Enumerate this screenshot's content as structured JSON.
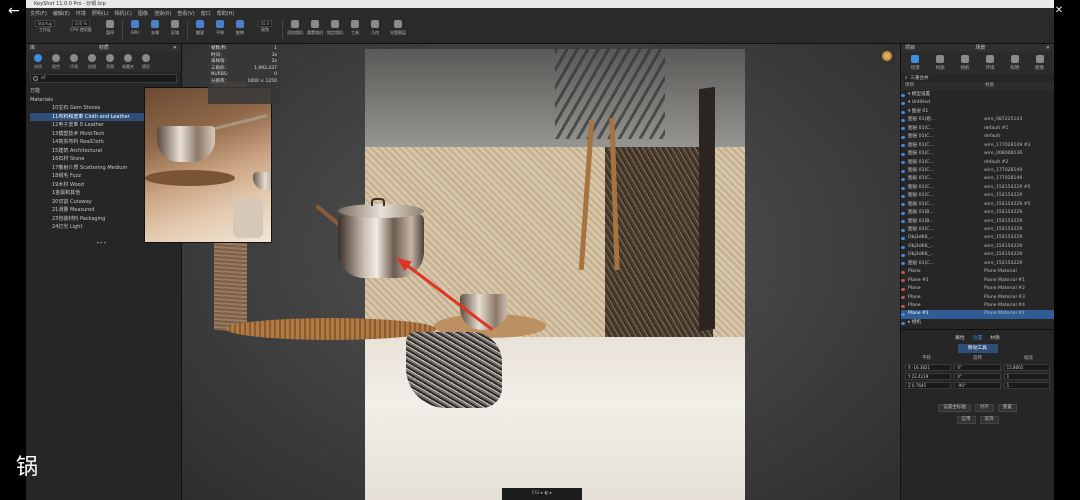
{
  "window": {
    "title": "KeyShot 11.0.0 Pro - 炒锅.bip",
    "controls": [
      "—",
      "▢",
      "✕"
    ]
  },
  "menu": [
    "文件(F)",
    "编辑(E)",
    "环境",
    "照明(L)",
    "相机(C)",
    "图像",
    "渲染(R)",
    "查看(V)",
    "窗口",
    "帮助(H)"
  ],
  "toolbar": {
    "workspace_value": "Startup",
    "workspace_label": "工作区",
    "cpu_value": "100 %",
    "cpu_label": "CPU 使用量",
    "pause_label": "暂停",
    "gpu_label": "GPU",
    "denoise_label": "去噪",
    "region_label": "区域",
    "tumble_label": "翻滚",
    "pan_label": "平移",
    "dolly_label": "推移",
    "fov_value": "45.0",
    "fov_label": "视角",
    "add_camera_label": "添加相机",
    "reset_camera_label": "重置相机",
    "lock_camera_label": "锁定相机",
    "tools_label": "工具",
    "geometry_label": "几何",
    "light_label": "光管图层"
  },
  "library": {
    "header_left": "库",
    "header_center": "材质",
    "tabs": [
      "材质",
      "颜色",
      "环境",
      "纹理",
      "背景",
      "收藏夹",
      "模型"
    ],
    "search_value": "ef",
    "tree": [
      {
        "label": "万能",
        "sub": false,
        "selected": false
      },
      {
        "label": "Materials",
        "sub": false,
        "selected": false
      },
      {
        "label": "10宝石 Gem Stones",
        "sub": true,
        "selected": false
      },
      {
        "label": "11布料和皮革 Cloth and Leather",
        "sub": true,
        "selected": true
      },
      {
        "label": "12电子皮革 E-Leather",
        "sub": true,
        "selected": false
      },
      {
        "label": "13模塑技术 Mold-Tech",
        "sub": true,
        "selected": false
      },
      {
        "label": "14真实布料 RealCloth",
        "sub": true,
        "selected": false
      },
      {
        "label": "15建筑 Architectural",
        "sub": true,
        "selected": false
      },
      {
        "label": "16石材 Stone",
        "sub": true,
        "selected": false
      },
      {
        "label": "17散射介质 Scattering Medium",
        "sub": true,
        "selected": false
      },
      {
        "label": "18绒毛 Fuzz",
        "sub": true,
        "selected": false
      },
      {
        "label": "19木材 Wood",
        "sub": true,
        "selected": false
      },
      {
        "label": "1金属和其他",
        "sub": true,
        "selected": false
      },
      {
        "label": "20切割 Cutaway",
        "sub": true,
        "selected": false
      },
      {
        "label": "21测量 Measured",
        "sub": true,
        "selected": false
      },
      {
        "label": "23包装材料 Packaging",
        "sub": true,
        "selected": false
      },
      {
        "label": "24灯光 Light",
        "sub": true,
        "selected": false
      }
    ]
  },
  "stats": [
    {
      "k": "帧数/秒：",
      "v": "1"
    },
    {
      "k": "时间：",
      "v": "3s"
    },
    {
      "k": "采样值：",
      "v": "2s"
    },
    {
      "k": "三角形：",
      "v": "1,992,437"
    },
    {
      "k": "NURBS：",
      "v": "0"
    },
    {
      "k": "分辨率：",
      "v": "1000 × 1250"
    }
  ],
  "viewport": {
    "bottom_bar": "FGI ▸ ◐ ▸"
  },
  "scene": {
    "header_left": "项目",
    "header_center": "场景",
    "tabs": [
      "场景",
      "材质",
      "相机",
      "环境",
      "照明",
      "图像"
    ],
    "filter_label": "三重合并",
    "col_name": "项目",
    "col_material": "材质",
    "rows": [
      {
        "name": "▾ 模型设置",
        "mat": "",
        "eye": "blue",
        "selected": false
      },
      {
        "name": "  ▾ Untitled",
        "mat": "",
        "eye": "blue",
        "selected": false
      },
      {
        "name": "    ▾ 图层 01",
        "mat": "",
        "eye": "blue",
        "selected": false
      },
      {
        "name": "      图层 01(组...",
        "mat": "wire_087225143",
        "eye": "blue",
        "selected": false
      },
      {
        "name": "      图层 01(C...",
        "mat": "default #1",
        "eye": "blue",
        "selected": false
      },
      {
        "name": "      图层 01(C...",
        "mat": "default",
        "eye": "blue",
        "selected": false
      },
      {
        "name": "      图层 01(C...",
        "mat": "wire_177028149 #3",
        "eye": "blue",
        "selected": false
      },
      {
        "name": "      图层 01(C...",
        "mat": "wire_008008136",
        "eye": "blue",
        "selected": false
      },
      {
        "name": "      图层 01(C...",
        "mat": "default #2",
        "eye": "blue",
        "selected": false
      },
      {
        "name": "      图层 01(C...",
        "mat": "wire_177028149",
        "eye": "blue",
        "selected": false
      },
      {
        "name": "      图层 01(C...",
        "mat": "wire_177028149",
        "eye": "blue",
        "selected": false
      },
      {
        "name": "      图层 01(C...",
        "mat": "wire_154154229 #5",
        "eye": "blue",
        "selected": false
      },
      {
        "name": "      图层 01(C...",
        "mat": "wire_154154229",
        "eye": "blue",
        "selected": false
      },
      {
        "name": "      图层 01(C...",
        "mat": "wire_154154229 #5",
        "eye": "blue",
        "selected": false
      },
      {
        "name": "      图层 01(B...",
        "mat": "wire_154154229",
        "eye": "blue",
        "selected": false
      },
      {
        "name": "      图层 01(B...",
        "mat": "wire_154154229",
        "eye": "blue",
        "selected": false
      },
      {
        "name": "      图层 01(C...",
        "mat": "wire_154154229",
        "eye": "blue",
        "selected": false
      },
      {
        "name": "      Obj3d66_...",
        "mat": "wire_154154229",
        "eye": "blue",
        "selected": false
      },
      {
        "name": "      Obj3d66_...",
        "mat": "wire_154154229",
        "eye": "blue",
        "selected": false
      },
      {
        "name": "      Obj3d66_...",
        "mat": "wire_154154229",
        "eye": "blue",
        "selected": false
      },
      {
        "name": "      图层 01(C...",
        "mat": "wire_154154229",
        "eye": "blue",
        "selected": false
      },
      {
        "name": "  Plane",
        "mat": "Plane Material",
        "eye": "red",
        "selected": false
      },
      {
        "name": "  Plane #1",
        "mat": "Plane Material #1",
        "eye": "red",
        "selected": false
      },
      {
        "name": "  Plane",
        "mat": "Plane Material #2",
        "eye": "red",
        "selected": false
      },
      {
        "name": "  Plane",
        "mat": "Plane Material #3",
        "eye": "red",
        "selected": false
      },
      {
        "name": "  Plane",
        "mat": "Plane Material #4",
        "eye": "red",
        "selected": false
      },
      {
        "name": "  Plane #1",
        "mat": "Plane Material #1",
        "eye": "blue",
        "selected": true
      },
      {
        "name": "▸ 相机",
        "mat": "",
        "eye": "blue",
        "selected": false
      }
    ],
    "pos_tabs": [
      "属性",
      "位置",
      "材质"
    ],
    "move_tool": "移动工具",
    "xf_headers": [
      "平移",
      "旋转",
      "缩放"
    ],
    "xf_rows": [
      [
        "X -16.3821",
        "0°",
        "15.8005"
      ],
      [
        "Y 22.4119",
        "0°",
        "1"
      ],
      [
        "Z 0.7645",
        "-90°",
        "1"
      ]
    ],
    "buttons": [
      "设置坐标轴",
      "对齐",
      "重置",
      "应用",
      "取消"
    ]
  },
  "caption": "锅"
}
